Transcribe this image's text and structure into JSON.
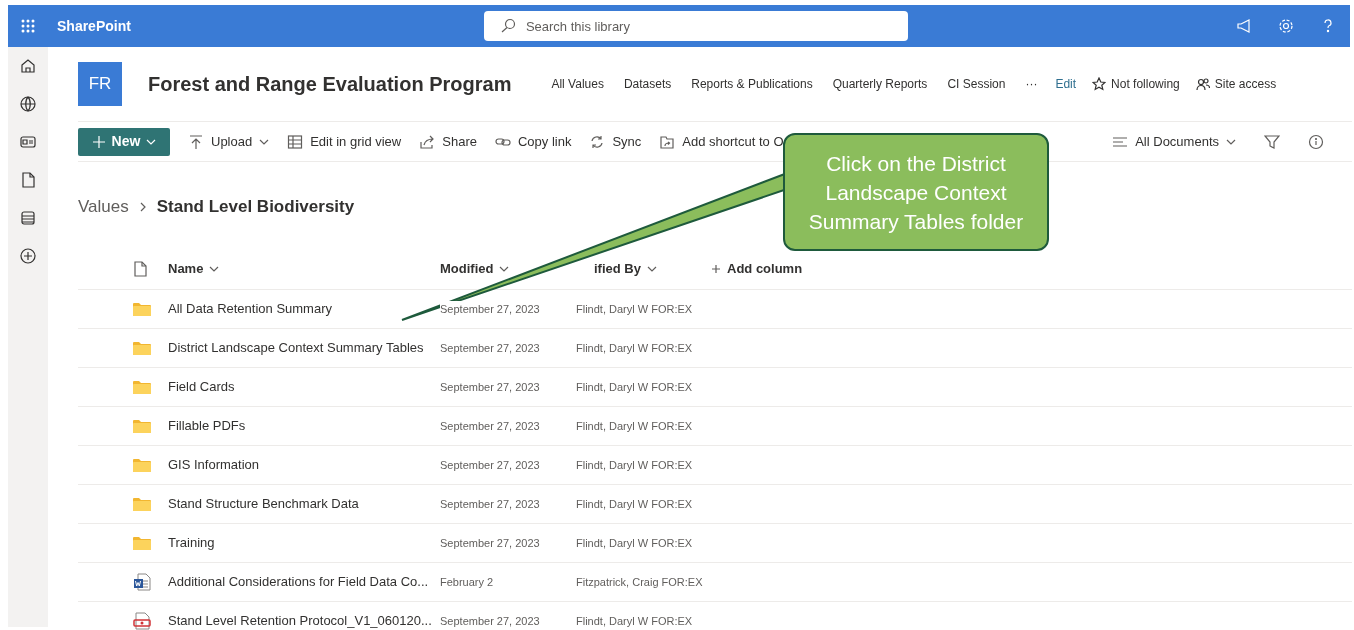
{
  "app_bar": {
    "app_name": "SharePoint",
    "search": {
      "placeholder": "Search this library"
    }
  },
  "site": {
    "logo": "FR",
    "title": "Forest and Range Evaluation Program",
    "nav": [
      {
        "label": "All Values"
      },
      {
        "label": "Datasets"
      },
      {
        "label": "Reports & Publications"
      },
      {
        "label": "Quarterly Reports"
      },
      {
        "label": "CI Session"
      },
      {
        "label": "···"
      }
    ],
    "actions": [
      {
        "label": "Edit",
        "kind": "link"
      },
      {
        "label": "Not following",
        "kind": "follow"
      },
      {
        "label": "Site access",
        "kind": "access"
      }
    ]
  },
  "command_bar": [
    {
      "label": "New",
      "kind": "primary"
    },
    {
      "label": "Upload",
      "kind": "upload"
    },
    {
      "label": "Edit in grid view",
      "kind": "grid"
    },
    {
      "label": "Share",
      "kind": "share"
    },
    {
      "label": "Copy link",
      "kind": "link"
    },
    {
      "label": "Sync",
      "kind": "sync"
    },
    {
      "label": "Add shortcut to O",
      "kind": "shortcut"
    }
  ],
  "view": {
    "label": "All Documents"
  },
  "breadcrumb": [
    {
      "label": "Values"
    },
    {
      "label": "Stand Level Biodiversity"
    }
  ],
  "table": {
    "columns": [
      "Name",
      "Modified",
      "ified By",
      "Add column"
    ],
    "rows": [
      {
        "kind": "folder",
        "name": "All Data Retention Summary",
        "modified": "September 27, 2023",
        "modified_by": "Flindt, Daryl W FOR:EX"
      },
      {
        "kind": "folder",
        "name": "District Landscape Context Summary Tables",
        "modified": "September 27, 2023",
        "modified_by": "Flindt, Daryl W FOR:EX"
      },
      {
        "kind": "folder",
        "name": "Field Cards",
        "modified": "September 27, 2023",
        "modified_by": "Flindt, Daryl W FOR:EX"
      },
      {
        "kind": "folder",
        "name": "Fillable PDFs",
        "modified": "September 27, 2023",
        "modified_by": "Flindt, Daryl W FOR:EX"
      },
      {
        "kind": "folder",
        "name": "GIS Information",
        "modified": "September 27, 2023",
        "modified_by": "Flindt, Daryl W FOR:EX"
      },
      {
        "kind": "folder",
        "name": "Stand Structure Benchmark Data",
        "modified": "September 27, 2023",
        "modified_by": "Flindt, Daryl W FOR:EX"
      },
      {
        "kind": "folder",
        "name": "Training",
        "modified": "September 27, 2023",
        "modified_by": "Flindt, Daryl W FOR:EX"
      },
      {
        "kind": "word",
        "name": "Additional Considerations for Field Data Co...",
        "modified": "February 2",
        "modified_by": "Fitzpatrick, Craig FOR:EX"
      },
      {
        "kind": "pdf",
        "name": "Stand Level Retention Protocol_V1_060120...",
        "modified": "September 27, 2023",
        "modified_by": "Flindt, Daryl W FOR:EX"
      }
    ]
  },
  "callout": {
    "text": "Click on the District Landscape Context Summary Tables folder"
  }
}
